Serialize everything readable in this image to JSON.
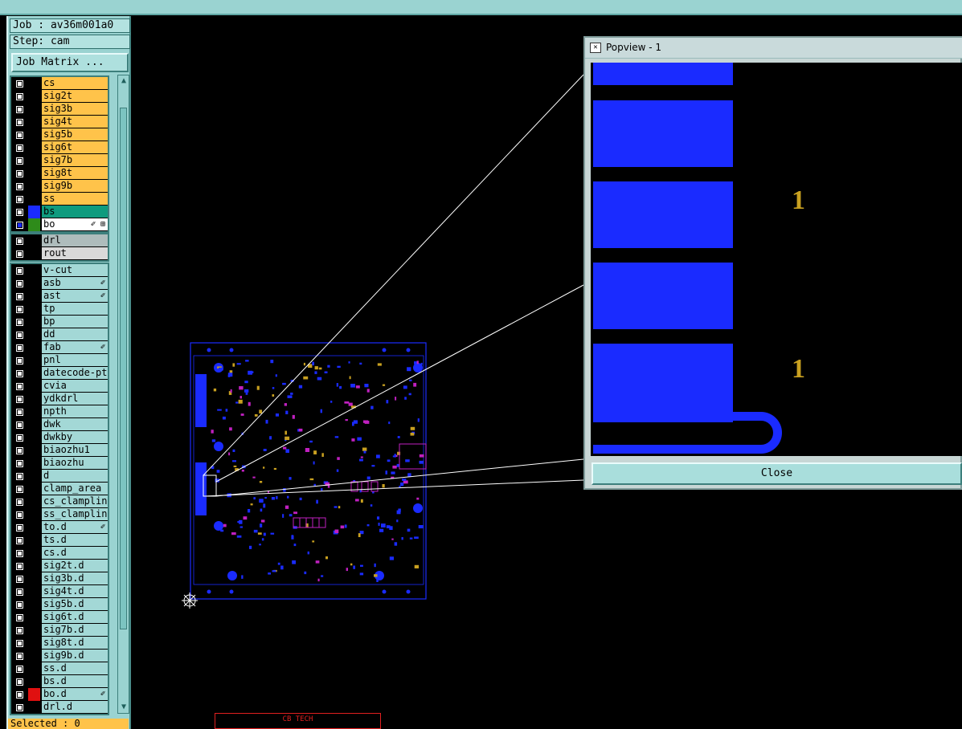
{
  "info": {
    "job": "Job : av36m001a0",
    "step": "Step: cam",
    "job_matrix_label": "Job Matrix ..."
  },
  "layers_board": [
    {
      "name": "cs",
      "bg": "#ffc34a",
      "swatch": "#000000",
      "checked": false,
      "mark": ""
    },
    {
      "name": "sig2t",
      "bg": "#ffc34a",
      "swatch": "#000000",
      "checked": false,
      "mark": ""
    },
    {
      "name": "sig3b",
      "bg": "#ffc34a",
      "swatch": "#000000",
      "checked": false,
      "mark": ""
    },
    {
      "name": "sig4t",
      "bg": "#ffc34a",
      "swatch": "#000000",
      "checked": false,
      "mark": ""
    },
    {
      "name": "sig5b",
      "bg": "#ffc34a",
      "swatch": "#000000",
      "checked": false,
      "mark": ""
    },
    {
      "name": "sig6t",
      "bg": "#ffc34a",
      "swatch": "#000000",
      "checked": false,
      "mark": ""
    },
    {
      "name": "sig7b",
      "bg": "#ffc34a",
      "swatch": "#000000",
      "checked": false,
      "mark": ""
    },
    {
      "name": "sig8t",
      "bg": "#ffc34a",
      "swatch": "#000000",
      "checked": false,
      "mark": ""
    },
    {
      "name": "sig9b",
      "bg": "#ffc34a",
      "swatch": "#000000",
      "checked": false,
      "mark": ""
    },
    {
      "name": "ss",
      "bg": "#ffc34a",
      "swatch": "#000000",
      "checked": false,
      "mark": ""
    },
    {
      "name": "bs",
      "bg": "#0f9b7e",
      "swatch": "#1a2bff",
      "checked": false,
      "mark": ""
    },
    {
      "name": "bo",
      "bg": "#ffffff",
      "swatch": "#2e8b1a",
      "checked": true,
      "mark": "✐ ⊞"
    }
  ],
  "layers_drill": [
    {
      "name": "drl",
      "bg": "#aebcbc",
      "swatch": "#000000",
      "checked": false,
      "mark": ""
    },
    {
      "name": "rout",
      "bg": "#d9d9d9",
      "swatch": "#000000",
      "checked": false,
      "mark": ""
    }
  ],
  "layers_misc": [
    {
      "name": "v-cut",
      "bg": "#a3d8d6",
      "swatch": "#000000",
      "checked": false,
      "mark": ""
    },
    {
      "name": "asb",
      "bg": "#a3d8d6",
      "swatch": "#000000",
      "checked": false,
      "mark": "✐"
    },
    {
      "name": "ast",
      "bg": "#a3d8d6",
      "swatch": "#000000",
      "checked": false,
      "mark": "✐"
    },
    {
      "name": "tp",
      "bg": "#a3d8d6",
      "swatch": "#000000",
      "checked": false,
      "mark": ""
    },
    {
      "name": "bp",
      "bg": "#a3d8d6",
      "swatch": "#000000",
      "checked": false,
      "mark": ""
    },
    {
      "name": "dd",
      "bg": "#a3d8d6",
      "swatch": "#000000",
      "checked": false,
      "mark": ""
    },
    {
      "name": "fab",
      "bg": "#a3d8d6",
      "swatch": "#000000",
      "checked": false,
      "mark": "✐"
    },
    {
      "name": "pnl",
      "bg": "#a3d8d6",
      "swatch": "#000000",
      "checked": false,
      "mark": ""
    },
    {
      "name": "datecode-pte",
      "bg": "#a3d8d6",
      "swatch": "#000000",
      "checked": false,
      "mark": ""
    },
    {
      "name": "cvia",
      "bg": "#a3d8d6",
      "swatch": "#000000",
      "checked": false,
      "mark": ""
    },
    {
      "name": "ydkdrl",
      "bg": "#a3d8d6",
      "swatch": "#000000",
      "checked": false,
      "mark": ""
    },
    {
      "name": "npth",
      "bg": "#a3d8d6",
      "swatch": "#000000",
      "checked": false,
      "mark": ""
    },
    {
      "name": "dwk",
      "bg": "#a3d8d6",
      "swatch": "#000000",
      "checked": false,
      "mark": ""
    },
    {
      "name": "dwkby",
      "bg": "#a3d8d6",
      "swatch": "#000000",
      "checked": false,
      "mark": ""
    },
    {
      "name": "biaozhu1",
      "bg": "#a3d8d6",
      "swatch": "#000000",
      "checked": false,
      "mark": ""
    },
    {
      "name": "biaozhu",
      "bg": "#a3d8d6",
      "swatch": "#000000",
      "checked": false,
      "mark": ""
    },
    {
      "name": "d",
      "bg": "#a3d8d6",
      "swatch": "#000000",
      "checked": false,
      "mark": ""
    },
    {
      "name": "clamp_area",
      "bg": "#a3d8d6",
      "swatch": "#000000",
      "checked": false,
      "mark": ""
    },
    {
      "name": "cs_clampline",
      "bg": "#a3d8d6",
      "swatch": "#000000",
      "checked": false,
      "mark": ""
    },
    {
      "name": "ss_clampline",
      "bg": "#a3d8d6",
      "swatch": "#000000",
      "checked": false,
      "mark": ""
    },
    {
      "name": "to.d",
      "bg": "#a3d8d6",
      "swatch": "#000000",
      "checked": false,
      "mark": "✐"
    },
    {
      "name": "ts.d",
      "bg": "#a3d8d6",
      "swatch": "#000000",
      "checked": false,
      "mark": ""
    },
    {
      "name": "cs.d",
      "bg": "#a3d8d6",
      "swatch": "#000000",
      "checked": false,
      "mark": ""
    },
    {
      "name": "sig2t.d",
      "bg": "#a3d8d6",
      "swatch": "#000000",
      "checked": false,
      "mark": ""
    },
    {
      "name": "sig3b.d",
      "bg": "#a3d8d6",
      "swatch": "#000000",
      "checked": false,
      "mark": ""
    },
    {
      "name": "sig4t.d",
      "bg": "#a3d8d6",
      "swatch": "#000000",
      "checked": false,
      "mark": ""
    },
    {
      "name": "sig5b.d",
      "bg": "#a3d8d6",
      "swatch": "#000000",
      "checked": false,
      "mark": ""
    },
    {
      "name": "sig6t.d",
      "bg": "#a3d8d6",
      "swatch": "#000000",
      "checked": false,
      "mark": ""
    },
    {
      "name": "sig7b.d",
      "bg": "#a3d8d6",
      "swatch": "#000000",
      "checked": false,
      "mark": ""
    },
    {
      "name": "sig8t.d",
      "bg": "#a3d8d6",
      "swatch": "#000000",
      "checked": false,
      "mark": ""
    },
    {
      "name": "sig9b.d",
      "bg": "#a3d8d6",
      "swatch": "#000000",
      "checked": false,
      "mark": ""
    },
    {
      "name": "ss.d",
      "bg": "#a3d8d6",
      "swatch": "#000000",
      "checked": false,
      "mark": ""
    },
    {
      "name": "bs.d",
      "bg": "#a3d8d6",
      "swatch": "#000000",
      "checked": false,
      "mark": ""
    },
    {
      "name": "bo.d",
      "bg": "#a3d8d6",
      "swatch": "#e01010",
      "checked": false,
      "mark": "✐"
    },
    {
      "name": "drl.d",
      "bg": "#a3d8d6",
      "swatch": "#000000",
      "checked": false,
      "mark": ""
    }
  ],
  "status": {
    "selected": "Selected : 0"
  },
  "popview": {
    "title": "Popview - 1",
    "close_label": "Close",
    "pad_labels": [
      "1",
      "1"
    ]
  },
  "footer_label": "CB TECH",
  "colors": {
    "background": "#000000",
    "panel": "#9ad3d1",
    "copper": "#1a2bff",
    "silk": "#c8a020",
    "accent_yellow": "#ffc34a"
  }
}
